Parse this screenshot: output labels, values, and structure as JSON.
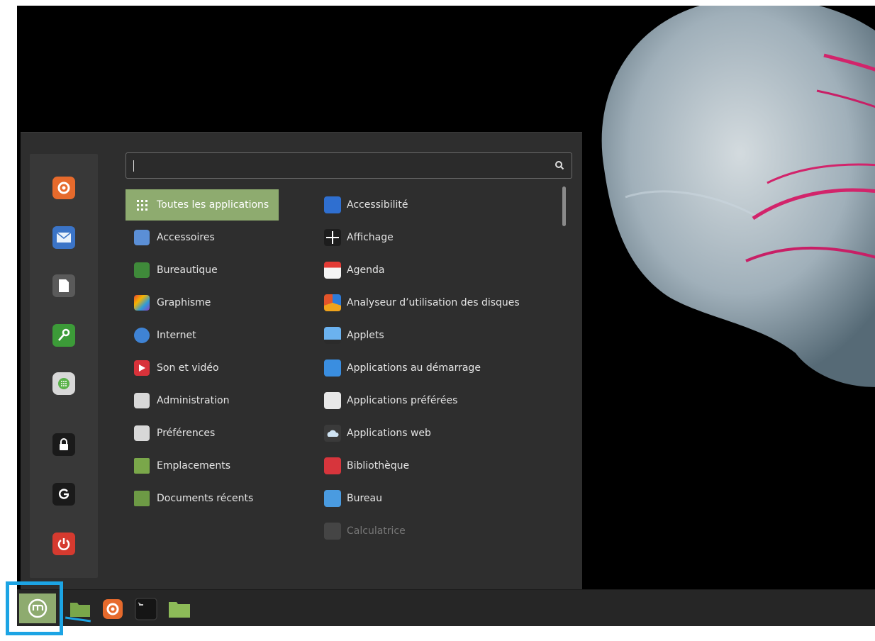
{
  "search": {
    "value": "",
    "placeholder": ""
  },
  "favorites": [
    {
      "name": "firefox-icon",
      "color": "#e66a2c"
    },
    {
      "name": "mail-icon",
      "color": "#3b74c7"
    },
    {
      "name": "document-icon",
      "color": "#5a5a5a"
    },
    {
      "name": "password-key-icon",
      "color": "#3c9b38"
    },
    {
      "name": "software-manager-icon",
      "color": "#d8d8d8"
    },
    {
      "name": "lock-icon",
      "color": "#1a1a1a"
    },
    {
      "name": "logout-icon",
      "color": "#1a1a1a"
    },
    {
      "name": "power-icon",
      "color": "#d53a2f"
    }
  ],
  "categories": [
    {
      "label": "Toutes les applications",
      "icon": "grid-icon",
      "selected": true
    },
    {
      "label": "Accessoires",
      "icon": "scissors-icon"
    },
    {
      "label": "Bureautique",
      "icon": "office-icon"
    },
    {
      "label": "Graphisme",
      "icon": "graphics-icon"
    },
    {
      "label": "Internet",
      "icon": "cloud-icon"
    },
    {
      "label": "Son et vidéo",
      "icon": "play-icon"
    },
    {
      "label": "Administration",
      "icon": "admin-icon"
    },
    {
      "label": "Préférences",
      "icon": "preferences-icon"
    },
    {
      "label": "Emplacements",
      "icon": "folder-icon"
    },
    {
      "label": "Documents récents",
      "icon": "recent-folder-icon"
    }
  ],
  "apps": [
    {
      "label": "Accessibilité",
      "icon": "accessibility-icon"
    },
    {
      "label": "Affichage",
      "icon": "display-icon"
    },
    {
      "label": "Agenda",
      "icon": "calendar-icon"
    },
    {
      "label": "Analyseur d’utilisation des disques",
      "icon": "disk-usage-icon"
    },
    {
      "label": "Applets",
      "icon": "applets-icon"
    },
    {
      "label": "Applications au démarrage",
      "icon": "startup-apps-icon"
    },
    {
      "label": "Applications préférées",
      "icon": "preferred-apps-icon"
    },
    {
      "label": "Applications web",
      "icon": "web-apps-icon"
    },
    {
      "label": "Bibliothèque",
      "icon": "library-icon"
    },
    {
      "label": "Bureau",
      "icon": "desktop-icon"
    },
    {
      "label": "Calculatrice",
      "icon": "calculator-icon",
      "dim": true
    }
  ],
  "panel": {
    "items": [
      "menu-button",
      "files-icon",
      "firefox-icon",
      "terminal-icon",
      "folder-icon"
    ],
    "accent": "#8eab6f",
    "highlight_color": "#1ca4e4"
  }
}
